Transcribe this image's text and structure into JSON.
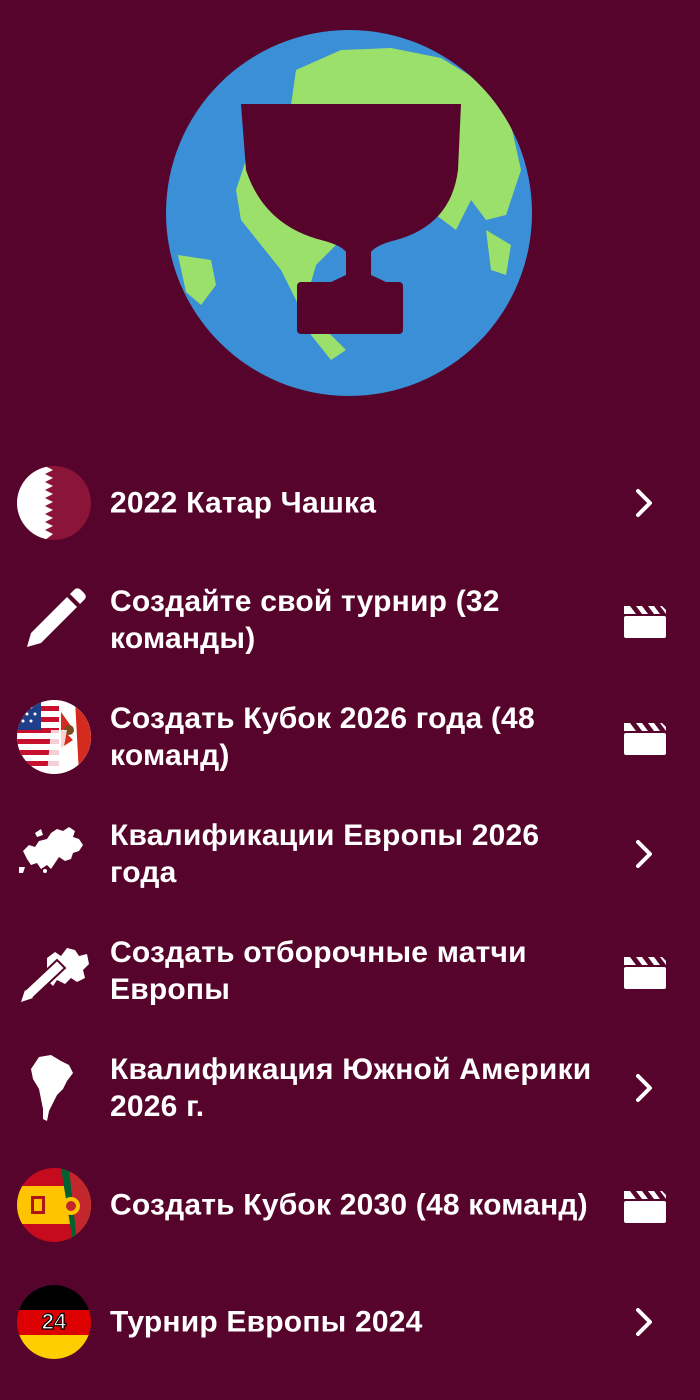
{
  "colors": {
    "background": "#56042c",
    "globe_ocean": "#3a8fd6",
    "globe_land": "#9be06b",
    "text": "#ffffff"
  },
  "logo": {
    "icon": "globe-trophy-icon"
  },
  "menu": {
    "items": [
      {
        "label": "2022 Катар Чашка",
        "icon": "qatar-flag-icon",
        "action": "chevron-right-icon"
      },
      {
        "label": "Создайте свой турнир (32 команды)",
        "icon": "pencil-icon",
        "action": "clapperboard-icon"
      },
      {
        "label": "Создать Кубок 2026 года (48 команд)",
        "icon": "usa-canada-mexico-flag-icon",
        "action": "clapperboard-icon"
      },
      {
        "label": "Квалификации Европы 2026 года",
        "icon": "europe-map-icon",
        "action": "chevron-right-icon"
      },
      {
        "label": "Создать отборочные матчи Европы",
        "icon": "europe-map-pencil-icon",
        "action": "clapperboard-icon"
      },
      {
        "label": "Квалификация Южной Америки 2026 г.",
        "icon": "south-america-map-icon",
        "action": "chevron-right-icon"
      },
      {
        "label": "Создать Кубок 2030 (48 команд)",
        "icon": "spain-portugal-morocco-flag-icon",
        "action": "clapperboard-icon"
      },
      {
        "label": "Турнир Европы 2024",
        "icon": "germany-flag-24-icon",
        "action": "chevron-right-icon"
      }
    ],
    "germany_badge_text": "24"
  }
}
